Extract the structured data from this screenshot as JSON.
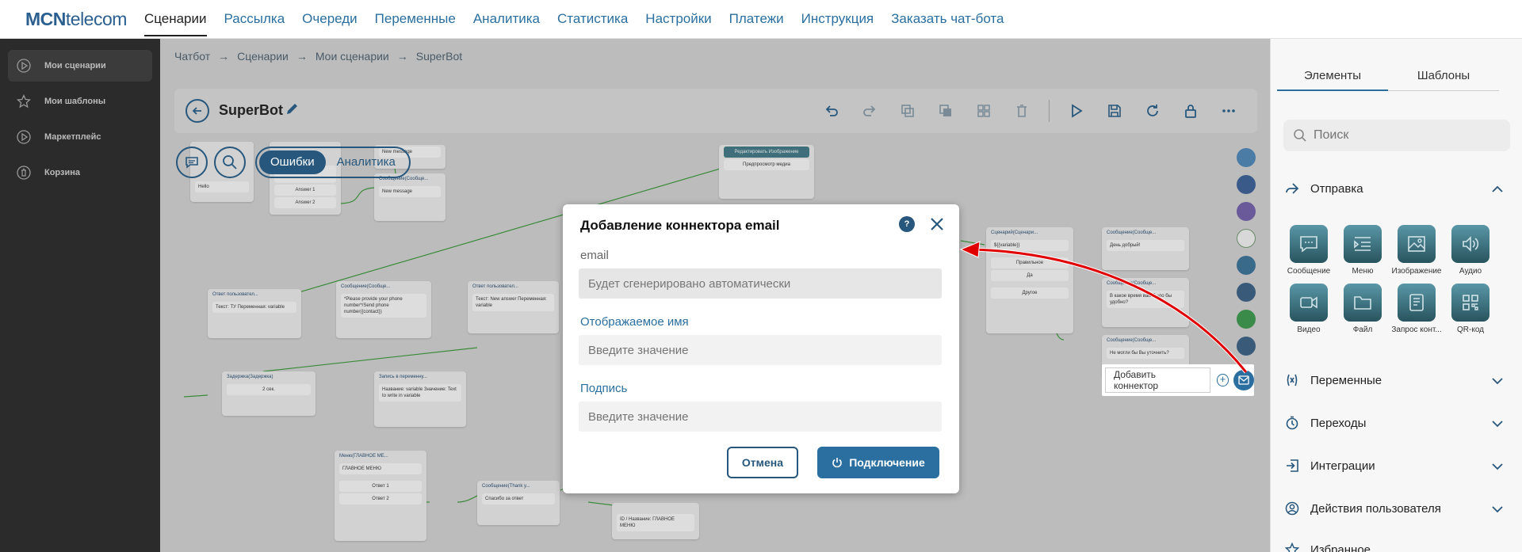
{
  "logo": {
    "bold": "MCN",
    "light": "telecom"
  },
  "topnav": [
    "Сценарии",
    "Рассылка",
    "Очереди",
    "Переменные",
    "Аналитика",
    "Статистика",
    "Настройки",
    "Платежи",
    "Инструкция",
    "Заказать чат-бота"
  ],
  "sidebar": {
    "items": [
      {
        "label": "Мои сценарии",
        "icon": "play-icon"
      },
      {
        "label": "Мои шаблоны",
        "icon": "star-icon"
      },
      {
        "label": "Маркетплейс",
        "icon": "play-icon"
      },
      {
        "label": "Корзина",
        "icon": "trash-icon"
      }
    ]
  },
  "breadcrumb": [
    "Чатбот",
    "Сценарии",
    "Мои сценарии",
    "SuperBot"
  ],
  "toolbar": {
    "title": "SuperBot"
  },
  "toggle": {
    "errors": "Ошибки",
    "analytics": "Аналитика"
  },
  "nodes": {
    "n1": {
      "body": "Hello"
    },
    "n2a": "Answer 1",
    "n2b": "Answer 2",
    "n3h": "New message",
    "n4h": "Сообщение(Сообще...",
    "n4b": "New message",
    "n5btn": "Редактировать Изображение",
    "n5b": "Предпросмотр медиа",
    "n6h": "Ответ пользовател...",
    "n6b": "Текст: ТУ Переменная: variable",
    "n7h": "Сообщение(Сообще...",
    "n7b": "*Please provide your phone number*/Send phone number({contact})",
    "n8h": "Ответ пользовател...",
    "n8b": "Текст: New answer Переменная: variable",
    "n9h": "Задержка(Задержка)",
    "n9b": "2 сек.",
    "n10h": "Запись в переменну...",
    "n10b": "Название: variable Значение: Text to write in variable",
    "n11h": "Меню(ГЛАВНОЕ МЕ...",
    "n11b": "ГЛАВНОЕ МЕНЮ",
    "n11o1": "Ответ 1",
    "n11o2": "Ответ 2",
    "n12h": "Сообщение(Thank y...",
    "n12b": "Спасибо за ответ",
    "n13b": "ID / Название: ГЛАВНОЕ МЕНЮ",
    "n14h": "Сценарий(Сценари...",
    "n14b": "${{variable}}",
    "n14o1": "Правильное",
    "n14o2": "Да",
    "n14o3": "Другое",
    "n15h": "Сообщение(Сообще...",
    "n15b": "День добрый!",
    "n16h": "Сообщение(Сообще...",
    "n16b": "В какое время вам было бы удобно?",
    "n17h": "Сообщение(Сообще...",
    "n17b": "Не могли бы Вы уточнить?"
  },
  "connector_popup": {
    "label": "Добавить коннектор"
  },
  "rightpanel": {
    "tabs": [
      "Элементы",
      "Шаблоны"
    ],
    "search_placeholder": "Поиск",
    "sections": [
      "Отправка",
      "Переменные",
      "Переходы",
      "Интеграции",
      "Действия пользователя",
      "Избранное"
    ],
    "grid": [
      "Сообщение",
      "Меню",
      "Изображение",
      "Аудио",
      "Видео",
      "Файл",
      "Запрос конт...",
      "QR-код"
    ]
  },
  "modal": {
    "title": "Добавление коннектора email",
    "help": "?",
    "email_label": "email",
    "email_value": "Будет сгенерировано автоматически",
    "display_label": "Отображаемое имя",
    "display_placeholder": "Введите значение",
    "signature_label": "Подпись",
    "signature_placeholder": "Введите значение",
    "cancel": "Отмена",
    "connect": "Подключение"
  },
  "colors": {
    "primary": "#2a6f9f",
    "dark": "#27577c",
    "arrow": "#e00000"
  }
}
